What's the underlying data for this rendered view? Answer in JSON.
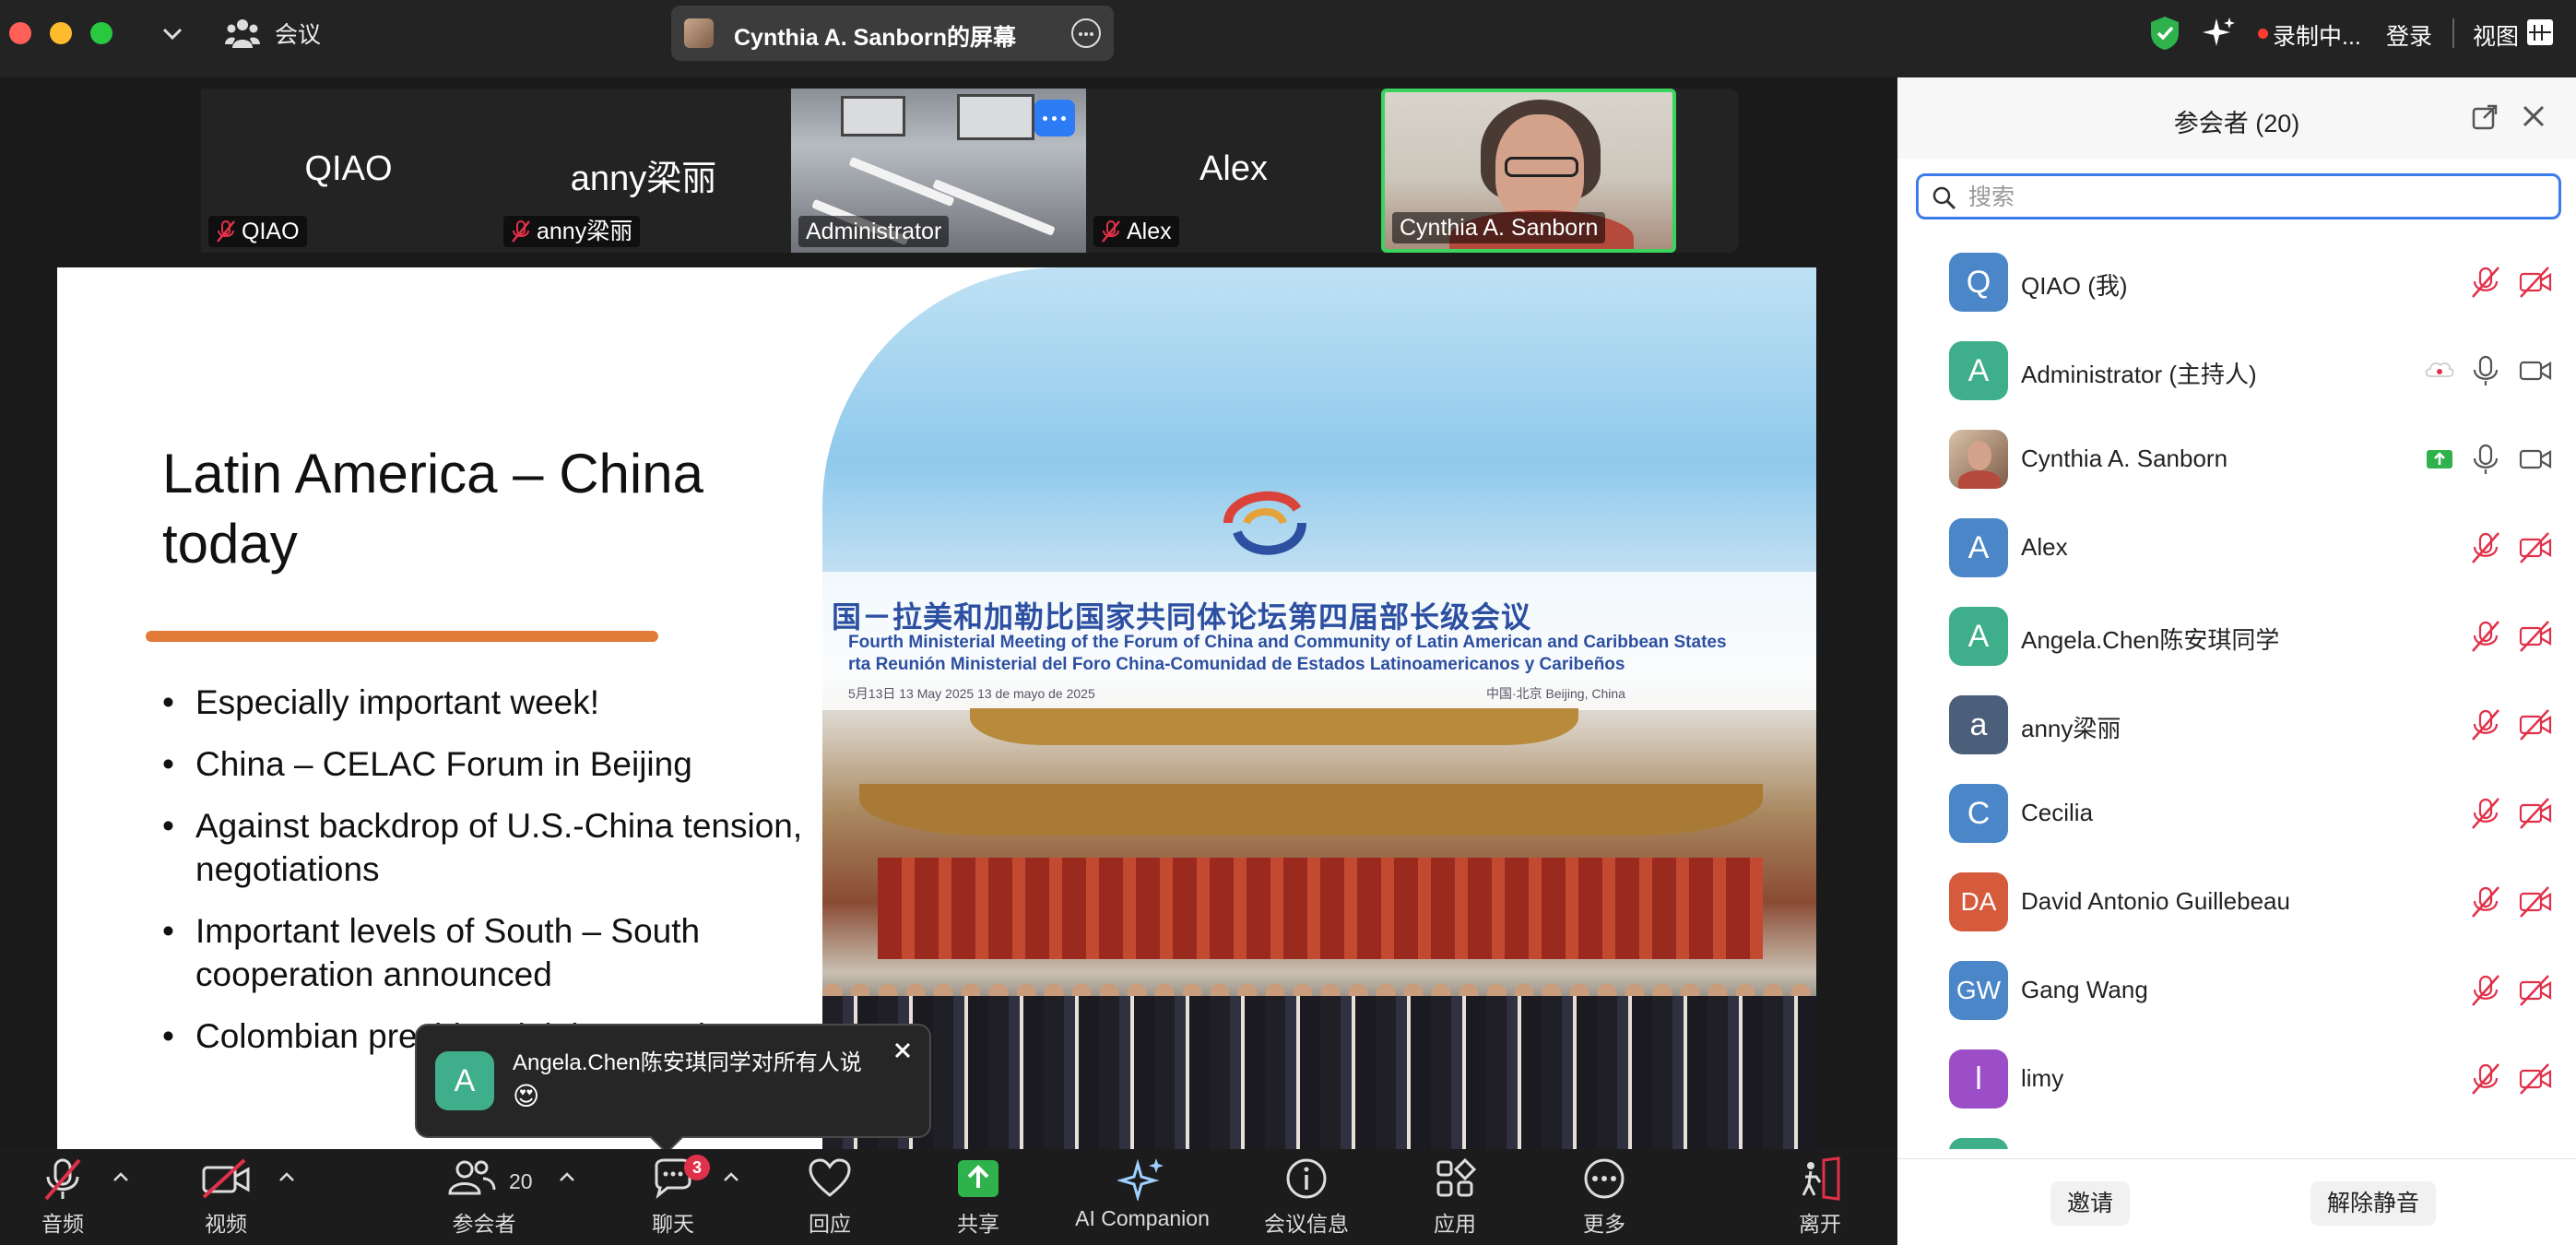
{
  "titlebar": {
    "meeting_label": "会议",
    "screen_share_title": "Cynthia A. Sanborn的屏幕",
    "recording_label": "录制中...",
    "login_label": "登录",
    "view_label": "视图"
  },
  "video_strip": {
    "tiles": [
      {
        "display_name": "QIAO",
        "label": "QIAO"
      },
      {
        "display_name": "anny梁丽",
        "label": "anny梁丽"
      },
      {
        "display_name": "",
        "label": "Administrator"
      },
      {
        "display_name": "Alex",
        "label": "Alex"
      },
      {
        "display_name": "",
        "label": "Cynthia A. Sanborn"
      }
    ]
  },
  "slide": {
    "title": "Latin America – China today",
    "bullets": [
      "Especially important week!",
      "China – CELAC Forum in Beijing",
      "Against backdrop of U.S.-China tension, negotiations",
      "Important levels of South – South cooperation announced",
      "Colombian president joining BRI (#"
    ],
    "photo_banner_cn": "国－拉美和加勒比国家共同体论坛第四届部长级会议",
    "photo_banner_en": "Fourth Ministerial Meeting of the Forum of China and Community of Latin American and Caribbean States",
    "photo_banner_es": "rta Reunión Ministerial del Foro China-Comunidad de Estados Latinoamericanos y Caribeños",
    "photo_date": "5月13日 13 May 2025 13 de mayo de 2025",
    "photo_place": "中国·北京          Beijing, China"
  },
  "chat_toast": {
    "avatar_letter": "A",
    "sender": "Angela.Chen陈安琪同学对所有人说",
    "message": "😍"
  },
  "toolbar": {
    "audio": "音频",
    "video": "视频",
    "participants": "参会者",
    "participant_count": "20",
    "chat": "聊天",
    "chat_badge": "3",
    "reactions": "回应",
    "share": "共享",
    "ai_companion": "AI Companion",
    "meeting_info": "会议信息",
    "apps": "应用",
    "more": "更多",
    "leave": "离开"
  },
  "panel": {
    "title": "参会者 (20)",
    "search_placeholder": "搜索",
    "participants": [
      {
        "initials": "Q",
        "name": "QIAO (我)",
        "color": "#4a86c8",
        "muted": true
      },
      {
        "initials": "A",
        "name": "Administrator (主持人)",
        "color": "#3fae8b",
        "muted": false
      },
      {
        "initials": "",
        "name": "Cynthia A. Sanborn",
        "color": "#a98e7e",
        "muted": false
      },
      {
        "initials": "A",
        "name": "Alex",
        "color": "#4a86c8",
        "muted": true
      },
      {
        "initials": "A",
        "name": "Angela.Chen陈安琪同学",
        "color": "#3fae8b",
        "muted": true
      },
      {
        "initials": "a",
        "name": "anny梁丽",
        "color": "#4b5f7a",
        "muted": true
      },
      {
        "initials": "C",
        "name": "Cecilia",
        "color": "#4a86c8",
        "muted": true
      },
      {
        "initials": "DA",
        "name": "David Antonio Guillebeau",
        "color": "#d65a3c",
        "muted": true
      },
      {
        "initials": "GW",
        "name": "Gang Wang",
        "color": "#4a86c8",
        "muted": true
      },
      {
        "initials": "l",
        "name": "limy",
        "color": "#9b4ec8",
        "muted": true
      }
    ],
    "invite_label": "邀请",
    "unmute_label": "解除静音"
  },
  "colors": {
    "accent_blue": "#3d7bea",
    "mute_red": "#e0314a",
    "share_green": "#2fb24c",
    "slide_underline": "#e07b3a"
  }
}
